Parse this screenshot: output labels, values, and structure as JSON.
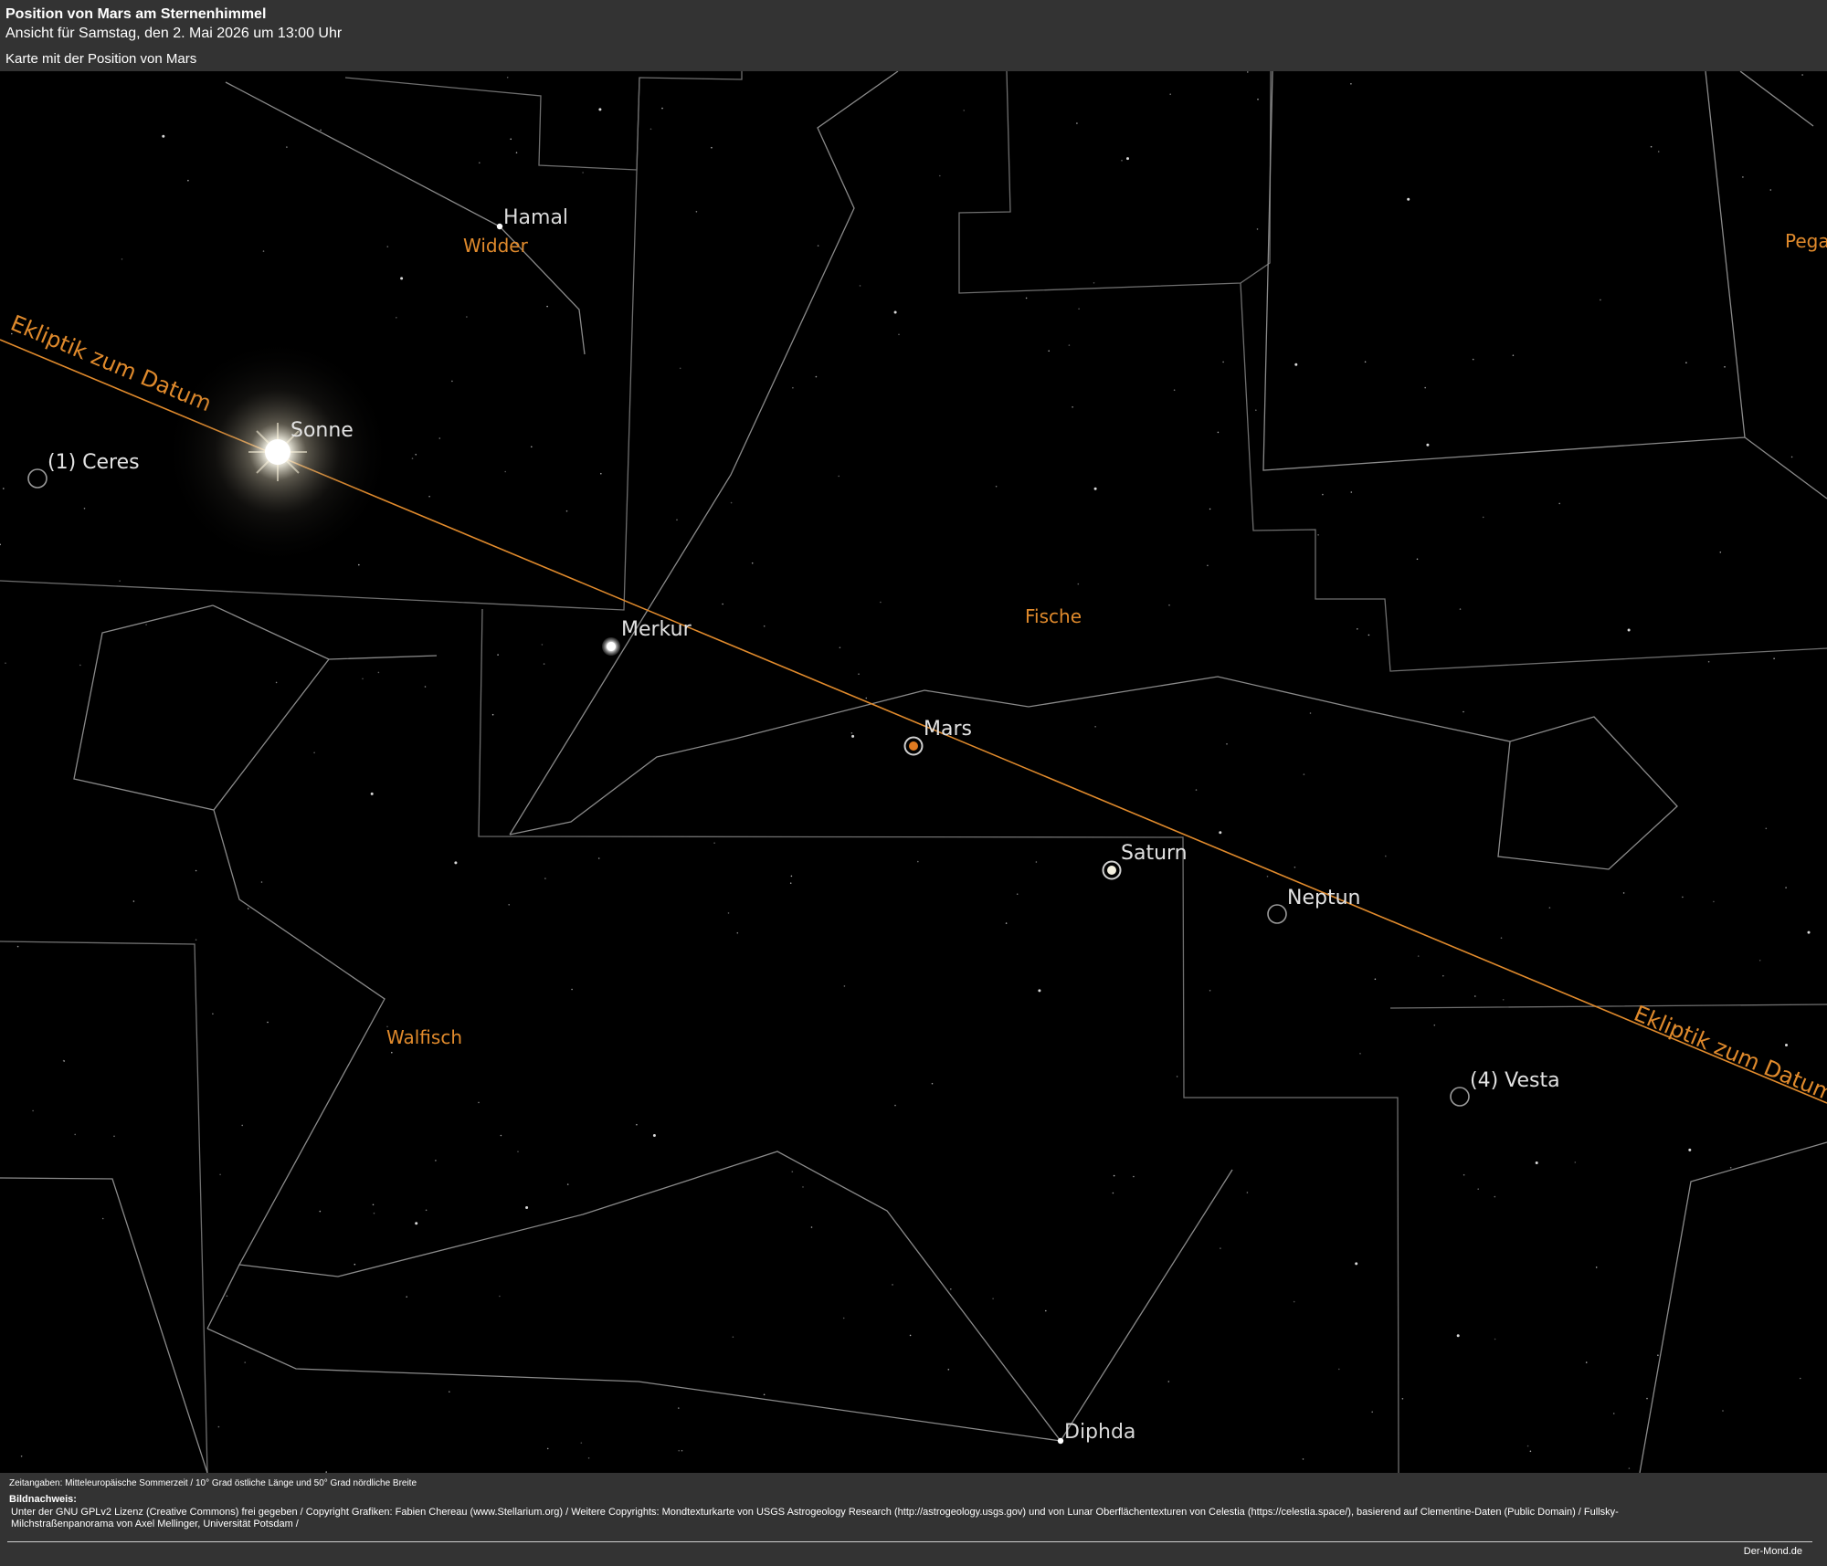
{
  "header": {
    "title": "Position von Mars am Sternenhimmel",
    "subtitle": "Ansicht für Samstag, den 2. Mai 2026 um 13:00 Uhr",
    "caption": "Karte mit der Position von Mars"
  },
  "map": {
    "ecliptic_label": "Ekliptik zum Datum",
    "constellations": {
      "aries": "Widder",
      "pisces": "Fische",
      "cetus": "Walfisch",
      "pegasus": "Pega"
    },
    "stars": {
      "hamal": "Hamal",
      "diphda": "Diphda"
    },
    "bodies": {
      "sun": "Sonne",
      "mercury": "Merkur",
      "mars": "Mars",
      "saturn": "Saturn",
      "neptune": "Neptun",
      "ceres": "(1) Ceres",
      "vesta": "(4) Vesta"
    },
    "colors": {
      "background": "#000000",
      "ecliptic": "#e08a2c",
      "constellation_label": "#e08a2c",
      "lines": "#8a8a8a",
      "mars": "#e07a20",
      "panel": "#333333"
    }
  },
  "footer": {
    "time_note": "Zeitangaben: Mitteleuropäische Sommerzeit / 10° Grad östliche Länge und 50° Grad nördliche Breite",
    "credits_heading": "Bildnachweis:",
    "credits_text": "Unter der GNU GPLv2 Lizenz (Creative Commons) frei gegeben / Copyright Grafiken: Fabien Chereau (www.Stellarium.org) / Weitere Copyrights: Mondtexturkarte von USGS Astrogeology Research (http://astrogeology.usgs.gov) und von Lunar Oberflächentexturen von Celestia (https://celestia.space/), basierend auf Clementine-Daten (Public Domain) / Fullsky-Milchstraßenpanorama von Axel Mellinger, Universität Potsdam /",
    "site": "Der-Mond.de"
  }
}
